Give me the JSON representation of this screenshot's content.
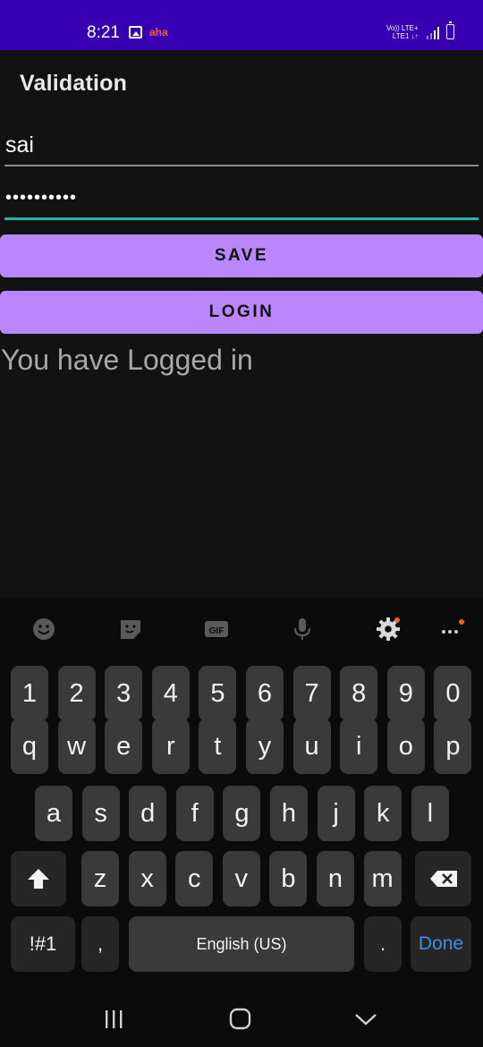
{
  "status_bar": {
    "time": "8:21",
    "carrier_icon_text": "aha",
    "network_line1": "Vo)) LTE+",
    "network_line2": "LTE1 ↓↑"
  },
  "app": {
    "title": "Validation"
  },
  "form": {
    "username_value": "sai",
    "password_value": "••••••••••",
    "save_label": "SAVE",
    "login_label": "LOGIN",
    "result_text": "You have Logged in"
  },
  "keyboard": {
    "toolbar": [
      "emoji-icon",
      "sticker-icon",
      "gif-icon",
      "mic-icon",
      "settings-icon",
      "more-icon"
    ],
    "gif_label": "GIF",
    "row_numbers": [
      "1",
      "2",
      "3",
      "4",
      "5",
      "6",
      "7",
      "8",
      "9",
      "0"
    ],
    "row_top": [
      "q",
      "w",
      "e",
      "r",
      "t",
      "y",
      "u",
      "i",
      "o",
      "p"
    ],
    "row_middle": [
      "a",
      "s",
      "d",
      "f",
      "g",
      "h",
      "j",
      "k",
      "l"
    ],
    "row_bottom": [
      "z",
      "x",
      "c",
      "v",
      "b",
      "n",
      "m"
    ],
    "symbols_label": "!#1",
    "comma_label": ",",
    "space_label": "English (US)",
    "period_label": ".",
    "done_label": "Done"
  },
  "colors": {
    "status_bar": "#3700B3",
    "button": "#BB86FC",
    "focus_underline": "#25b59f",
    "done": "#3d8ee6"
  }
}
